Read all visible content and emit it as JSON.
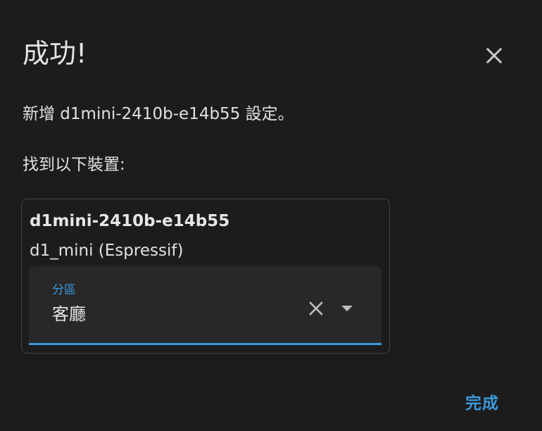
{
  "dialog": {
    "title": "成功!",
    "message": "新增 d1mini-2410b-e14b55 設定。",
    "found_label": "找到以下裝置:",
    "device": {
      "name": "d1mini-2410b-e14b55",
      "model": "d1_mini (Espressif)"
    },
    "area_field": {
      "label": "分區",
      "value": "客廳"
    },
    "done_label": "完成",
    "icons": {
      "close": "close-icon",
      "clear": "clear-icon",
      "dropdown": "arrow-drop-down-icon"
    },
    "colors": {
      "background": "#1c1c1c",
      "accent": "#3a99dc",
      "field_background": "#282828",
      "text": "#e1e1e1"
    }
  }
}
